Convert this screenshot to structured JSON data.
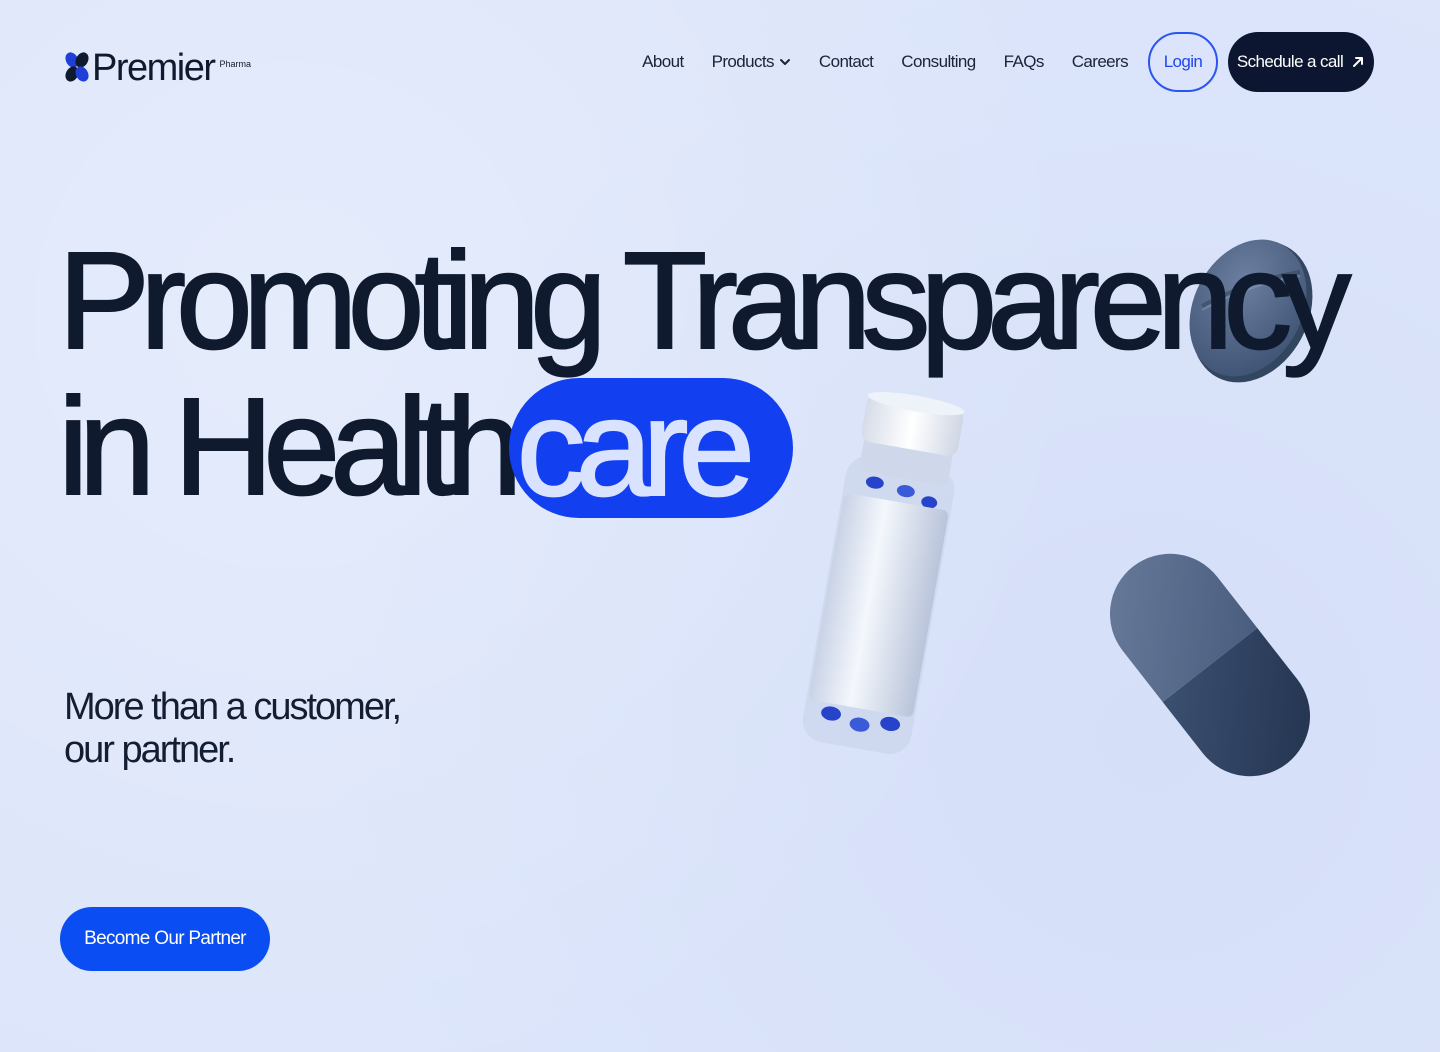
{
  "brand": {
    "name": "Premier",
    "sub": "Pharma"
  },
  "nav": {
    "links": [
      {
        "label": "About"
      },
      {
        "label": "Products",
        "has_dropdown": true
      },
      {
        "label": "Contact"
      },
      {
        "label": "Consulting"
      },
      {
        "label": "FAQs"
      },
      {
        "label": "Careers"
      }
    ],
    "login_label": "Login",
    "schedule_label": "Schedule a call"
  },
  "hero": {
    "line1": "Promoting Transparency",
    "line2_prefix": "in Health",
    "line2_highlight": "care",
    "subtitle_line1": "More than a customer,",
    "subtitle_line2": "our partner.",
    "cta_label": "Become Our Partner"
  },
  "icons": {
    "logo": "pharma-cross-logo-icon",
    "products_dropdown": "chevron-down-icon",
    "schedule_arrow": "arrow-up-right-icon"
  },
  "colors": {
    "background": "#dce5fa",
    "primary_dark": "#0c1630",
    "accent_blue": "#1240f0",
    "pill_slate": "#4a5e80",
    "pill_dark": "#2d3e5c"
  }
}
